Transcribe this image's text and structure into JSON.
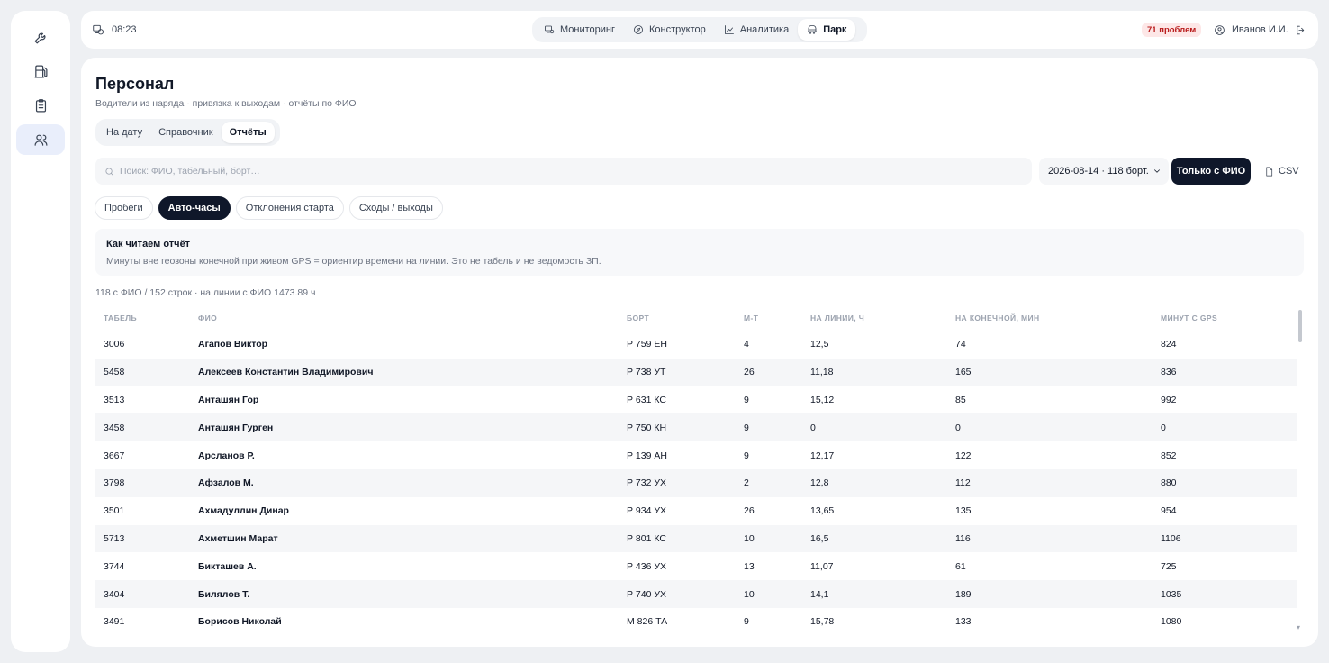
{
  "topbar": {
    "time": "08:23",
    "nav": [
      {
        "label": "Мониторинг",
        "icon": "monitor-icon",
        "active": false
      },
      {
        "label": "Конструктор",
        "icon": "compass-icon",
        "active": false
      },
      {
        "label": "Аналитика",
        "icon": "chart-icon",
        "active": false
      },
      {
        "label": "Парк",
        "icon": "bus-icon",
        "active": true
      }
    ],
    "problems": "71 проблем",
    "user": "Иванов И.И."
  },
  "sidebar": [
    {
      "icon": "wrench-icon",
      "active": false
    },
    {
      "icon": "fuel-icon",
      "active": false
    },
    {
      "icon": "clipboard-icon",
      "active": false
    },
    {
      "icon": "users-icon",
      "active": true
    }
  ],
  "page": {
    "title": "Персонал",
    "subtitle": "Водители из наряда · привязка к выходам · отчёты по ФИО",
    "subtabs": [
      "На дату",
      "Справочник",
      "Отчёты"
    ],
    "active_subtab": "Отчёты"
  },
  "filters": {
    "search_placeholder": "Поиск: ФИО, табельный, борт…",
    "date_select": "2026-08-14 · 118 борт.",
    "only_fio": "Только с ФИО",
    "csv": "CSV"
  },
  "report_tabs": [
    "Пробеги",
    "Авто-часы",
    "Отклонения старта",
    "Сходы / выходы"
  ],
  "active_report_tab": "Авто-часы",
  "info": {
    "title": "Как читаем отчёт",
    "text": "Минуты вне геозоны конечной при живом GPS = ориентир времени на линии. Это не табель и не ведомость ЗП."
  },
  "summary": "118 с ФИО / 152 строк · на линии с ФИО 1473.89 ч",
  "table": {
    "headers": [
      "ТАБЕЛЬ",
      "ФИО",
      "БОРТ",
      "М-Т",
      "НА ЛИНИИ, Ч",
      "НА КОНЕЧНОЙ, МИН",
      "МИНУТ С GPS"
    ],
    "rows": [
      [
        "3006",
        "Агапов Виктор",
        "Р 759 ЕН",
        "4",
        "12,5",
        "74",
        "824"
      ],
      [
        "5458",
        "Алексеев Константин Владимирович",
        "Р 738 УТ",
        "26",
        "11,18",
        "165",
        "836"
      ],
      [
        "3513",
        "Анташян Гор",
        "Р 631 КС",
        "9",
        "15,12",
        "85",
        "992"
      ],
      [
        "3458",
        "Анташян Гурген",
        "Р 750 КН",
        "9",
        "0",
        "0",
        "0"
      ],
      [
        "3667",
        "Арсланов Р.",
        "Р 139 АН",
        "9",
        "12,17",
        "122",
        "852"
      ],
      [
        "3798",
        "Афзалов М.",
        "Р 732 УХ",
        "2",
        "12,8",
        "112",
        "880"
      ],
      [
        "3501",
        "Ахмадуллин Динар",
        "Р 934 УХ",
        "26",
        "13,65",
        "135",
        "954"
      ],
      [
        "5713",
        "Ахметшин Марат",
        "Р 801 КС",
        "10",
        "16,5",
        "116",
        "1106"
      ],
      [
        "3744",
        "Бикташев А.",
        "Р 436 УХ",
        "13",
        "11,07",
        "61",
        "725"
      ],
      [
        "3404",
        "Билялов Т.",
        "Р 740 УХ",
        "10",
        "14,1",
        "189",
        "1035"
      ],
      [
        "3491",
        "Борисов Николай",
        "М 826 ТА",
        "9",
        "15,78",
        "133",
        "1080"
      ]
    ]
  }
}
